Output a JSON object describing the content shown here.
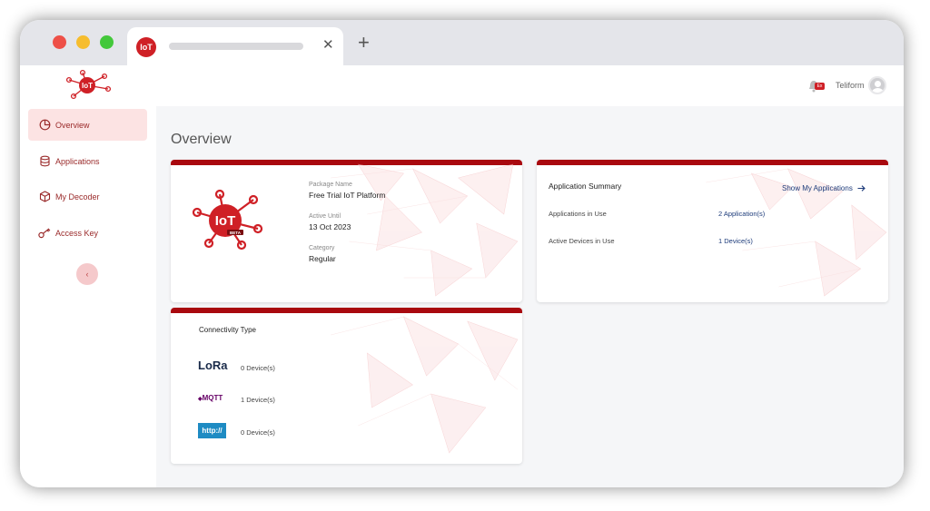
{
  "browser": {
    "tab_favicon_text": "IoT",
    "new_tab_symbol": "+",
    "close_symbol": "✕",
    "traffic_lights": [
      "#ee5048",
      "#f6bd2e",
      "#43c83b"
    ]
  },
  "header": {
    "logo_text": "IoT",
    "logo_badge": "BETA",
    "notification_badge": "Ex",
    "user_name": "Teliform"
  },
  "sidebar": {
    "items": [
      {
        "label": "Overview",
        "icon": "pie-chart-icon",
        "active": true
      },
      {
        "label": "Applications",
        "icon": "database-icon",
        "active": false
      },
      {
        "label": "My Decoder",
        "icon": "cube-icon",
        "active": false
      },
      {
        "label": "Access Key",
        "icon": "key-icon",
        "active": false
      }
    ],
    "collapse_symbol": "‹"
  },
  "main": {
    "title": "Overview",
    "package_card": {
      "logo_text": "IoT",
      "logo_badge": "BETA",
      "package_name_label": "Package Name",
      "package_name": "Free Trial IoT Platform",
      "active_until_label": "Active Until",
      "active_until": "13 Oct 2023",
      "category_label": "Category",
      "category": "Regular"
    },
    "app_summary": {
      "title": "Application Summary",
      "show_link": "Show My Applications",
      "rows": [
        {
          "label": "Applications in Use",
          "value": "2 Application(s)"
        },
        {
          "label": "Active Devices in Use",
          "value": "1 Device(s)"
        }
      ]
    },
    "connectivity": {
      "title": "Connectivity Type",
      "items": [
        {
          "name": "LoRa",
          "count": "0 Device(s)"
        },
        {
          "name": "MQTT",
          "count": "1 Device(s)"
        },
        {
          "name": "http://",
          "count": "0 Device(s)"
        }
      ]
    }
  },
  "colors": {
    "brand_red": "#cf2026",
    "card_bar": "#a9090f",
    "active_nav_bg": "#fce3e3",
    "link_blue": "#1d3b7a"
  }
}
